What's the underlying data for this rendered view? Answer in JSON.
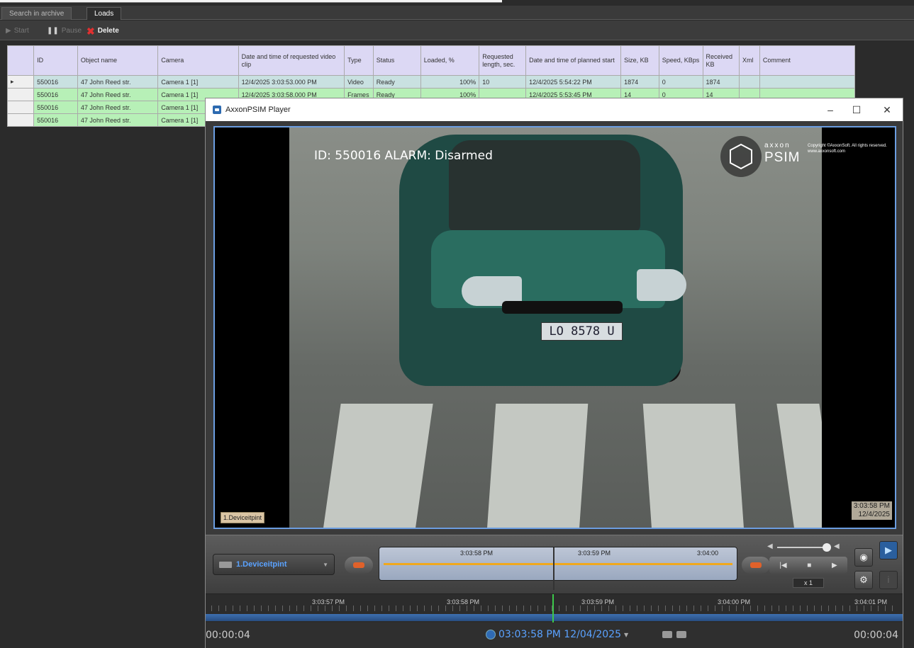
{
  "tabs": [
    {
      "label": "Search in archive",
      "active": false
    },
    {
      "label": "Loads",
      "active": true
    }
  ],
  "toolbar": {
    "start_label": "Start",
    "pause_label": "Pause",
    "delete_label": "Delete"
  },
  "table": {
    "columns": [
      "",
      "ID",
      "Object name",
      "Camera",
      "Date and time of requested video clip",
      "Type",
      "Status",
      "Loaded, %",
      "Requested length, sec.",
      "Date and time of planned start",
      "Size, KB",
      "Speed, KBps",
      "Received KB",
      "Xml",
      "Comment"
    ],
    "rows": [
      {
        "marker": "▸",
        "id": "550016",
        "object": "47 John Reed str.",
        "camera": "Camera 1 [1]",
        "datetime": "12/4/2025 3:03:53.000 PM",
        "type": "Video",
        "status": "Ready",
        "loaded": "100%",
        "length": "10",
        "planned": "12/4/2025 5:54:22 PM",
        "size": "1874",
        "speed": "0",
        "received": "1874",
        "xml": "",
        "comment": ""
      },
      {
        "marker": "",
        "id": "550016",
        "object": "47 John Reed str.",
        "camera": "Camera 1 [1]",
        "datetime": "12/4/2025 3:03:58.000 PM",
        "type": "Frames",
        "status": "Ready",
        "loaded": "100%",
        "length": "",
        "planned": "12/4/2025 5:53:45 PM",
        "size": "14",
        "speed": "0",
        "received": "14",
        "xml": "",
        "comment": ""
      },
      {
        "marker": "",
        "id": "550016",
        "object": "47 John Reed str.",
        "camera": "Camera 1 [1]",
        "datetime": "",
        "type": "",
        "status": "",
        "loaded": "",
        "length": "",
        "planned": "",
        "size": "",
        "speed": "",
        "received": "",
        "xml": "",
        "comment": ""
      },
      {
        "marker": "",
        "id": "550016",
        "object": "47 John Reed str.",
        "camera": "Camera 1 [1]",
        "datetime": "",
        "type": "",
        "status": "",
        "loaded": "",
        "length": "",
        "planned": "",
        "size": "",
        "speed": "",
        "received": "",
        "xml": "",
        "comment": ""
      }
    ]
  },
  "player": {
    "title": "AxxonPSIM Player",
    "minimize": "–",
    "maximize": "☐",
    "close": "✕",
    "overlay_text": "ID: 550016  ALARM: Disarmed",
    "plate": "LO 8578 U",
    "logo_brand": "axxon",
    "logo_product": "PSIM",
    "logo_copyright": "Copyright ©AxxonSoft. All rights reserved. www.axxonsoft.com",
    "camera_label": "1.Deviceitpint",
    "overlay_time": "3:03:58 PM",
    "overlay_date": "12/4/2025",
    "camera_select": "1.Deviceitpint",
    "timeline_labels": [
      "3:03:58 PM",
      "3:03:59 PM",
      "3:04:00"
    ],
    "speed": "x 1",
    "ruler_labels": [
      "3:03:57 PM",
      "3:03:58 PM",
      "3:03:59 PM",
      "3:04:00 PM",
      "3:04:01 PM"
    ],
    "time_left": "00:00:04",
    "time_right": "00:00:04",
    "current_datetime": "03:03:58 PM 12/04/2025"
  },
  "colors": {
    "header_bg": "#dcd8f4",
    "row_green": "#b7f0b7",
    "accent_blue": "#5aa2ff",
    "timeline_orange": "#f0a81c"
  }
}
